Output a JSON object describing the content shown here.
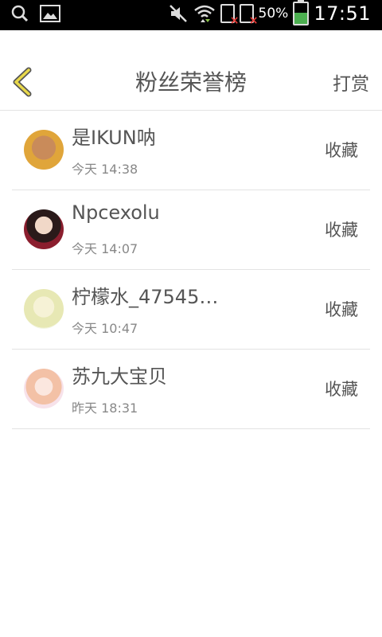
{
  "status_bar": {
    "battery_percent": "50%",
    "time": "17:51"
  },
  "header": {
    "title": "粉丝荣誉榜",
    "right_action": "打赏"
  },
  "fans": [
    {
      "name": "是IKUN呐",
      "time": "今天 14:38",
      "action": "收藏"
    },
    {
      "name": "Npcexolu",
      "time": "今天 14:07",
      "action": "收藏"
    },
    {
      "name": "柠檬水_47545…",
      "time": "今天 10:47",
      "action": "收藏"
    },
    {
      "name": "苏九大宝贝",
      "time": "昨天 18:31",
      "action": "收藏"
    }
  ],
  "colors": {
    "accent": "#e8d84a",
    "text": "#555555",
    "subtext": "#888888",
    "divider": "#e3e3e3"
  }
}
